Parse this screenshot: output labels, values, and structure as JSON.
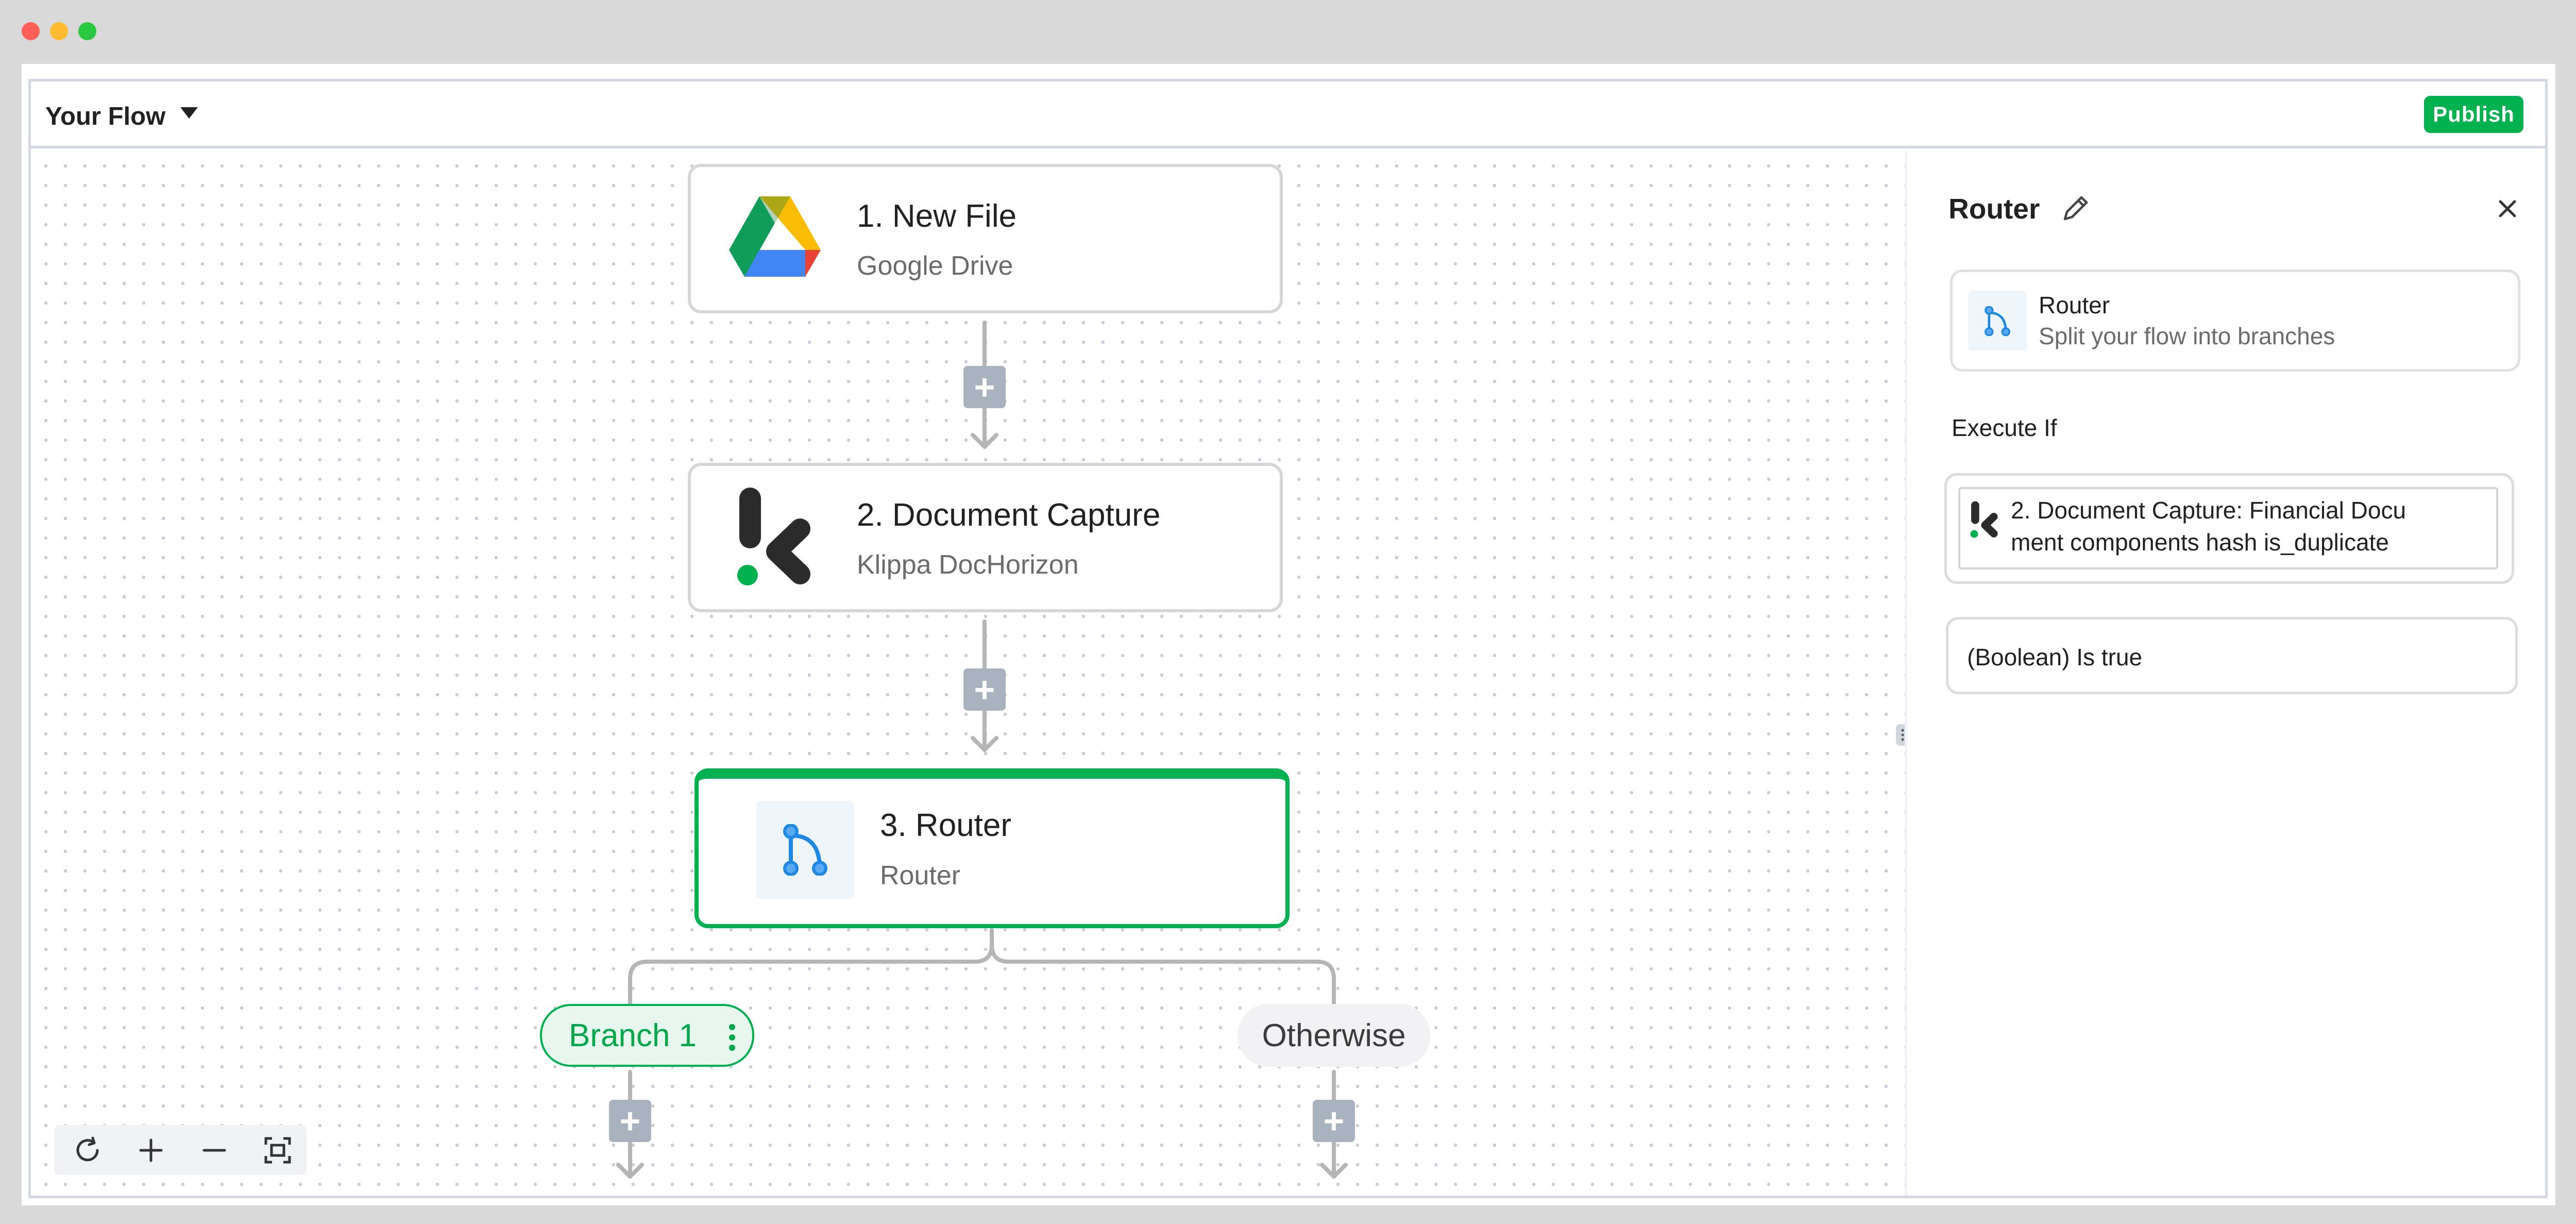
{
  "window": {
    "controls": [
      "close",
      "minimize",
      "maximize"
    ]
  },
  "header": {
    "title": "Your Flow",
    "publish_label": "Publish"
  },
  "nodes": [
    {
      "title": "1. New File",
      "subtitle": "Google Drive",
      "icon": "google-drive-icon"
    },
    {
      "title": "2. Document Capture",
      "subtitle": "Klippa DocHorizon",
      "icon": "klippa-icon"
    },
    {
      "title": "3. Router",
      "subtitle": "Router",
      "icon": "router-icon"
    }
  ],
  "branches": [
    {
      "label": "Branch 1",
      "active": true
    },
    {
      "label": "Otherwise",
      "active": false
    }
  ],
  "zoom_controls": [
    "refresh-icon",
    "zoom-in-icon",
    "zoom-out-icon",
    "fit-screen-icon"
  ],
  "panel": {
    "title": "Router",
    "step_card": {
      "name": "Router",
      "description": "Split your flow into branches"
    },
    "execute_if_label": "Execute If",
    "condition_value": "2. Document Capture: Financial Document components hash is_duplicate",
    "condition_line1": "2. Document Capture: Financial Docu",
    "condition_line2": "ment components hash is_duplicate",
    "operator": "(Boolean) Is true"
  },
  "colors": {
    "accent": "#00b14f",
    "router_blue": "#1e88e5",
    "plus_gray": "#a9b2bf"
  }
}
